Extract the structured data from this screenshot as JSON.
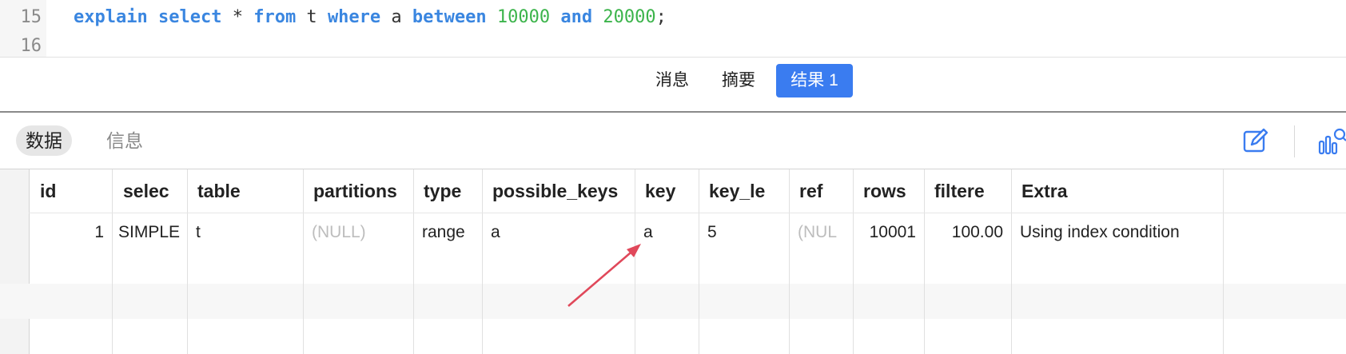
{
  "editor": {
    "lines": [
      {
        "number": "15",
        "tokens": [
          {
            "t": "explain",
            "c": "kw"
          },
          {
            "t": " ",
            "c": "plain"
          },
          {
            "t": "select",
            "c": "kw"
          },
          {
            "t": " * ",
            "c": "plain"
          },
          {
            "t": "from",
            "c": "kw"
          },
          {
            "t": " t ",
            "c": "plain"
          },
          {
            "t": "where",
            "c": "kw"
          },
          {
            "t": " a ",
            "c": "plain"
          },
          {
            "t": "between",
            "c": "kw"
          },
          {
            "t": " ",
            "c": "plain"
          },
          {
            "t": "10000",
            "c": "num"
          },
          {
            "t": " ",
            "c": "plain"
          },
          {
            "t": "and",
            "c": "kw"
          },
          {
            "t": " ",
            "c": "plain"
          },
          {
            "t": "20000",
            "c": "num"
          },
          {
            "t": ";",
            "c": "plain"
          }
        ]
      },
      {
        "number": "16",
        "tokens": []
      }
    ]
  },
  "result_tabs": [
    {
      "label": "消息",
      "active": false
    },
    {
      "label": "摘要",
      "active": false
    },
    {
      "label": "结果 1",
      "active": true
    }
  ],
  "view_toggle": {
    "data_label": "数据",
    "info_label": "信息",
    "selected": "数据"
  },
  "toolbar_icons": [
    "edit-icon",
    "chart-search-icon"
  ],
  "grid": {
    "columns": [
      "id",
      "selec",
      "table",
      "partitions",
      "type",
      "possible_keys",
      "key",
      "key_le",
      "ref",
      "rows",
      "filtere",
      "Extra"
    ],
    "rows": [
      [
        "1",
        "SIMPLE",
        "t",
        "(NULL)",
        "range",
        "a",
        "a",
        "5",
        "(NUL",
        "10001",
        "100.00",
        "Using index condition"
      ]
    ]
  },
  "colors": {
    "accent": "#3a7cf0",
    "keyword": "#3a86e0",
    "number": "#3cb44b",
    "arrow": "#e0485a",
    "null_text": "#bdbdbd"
  }
}
